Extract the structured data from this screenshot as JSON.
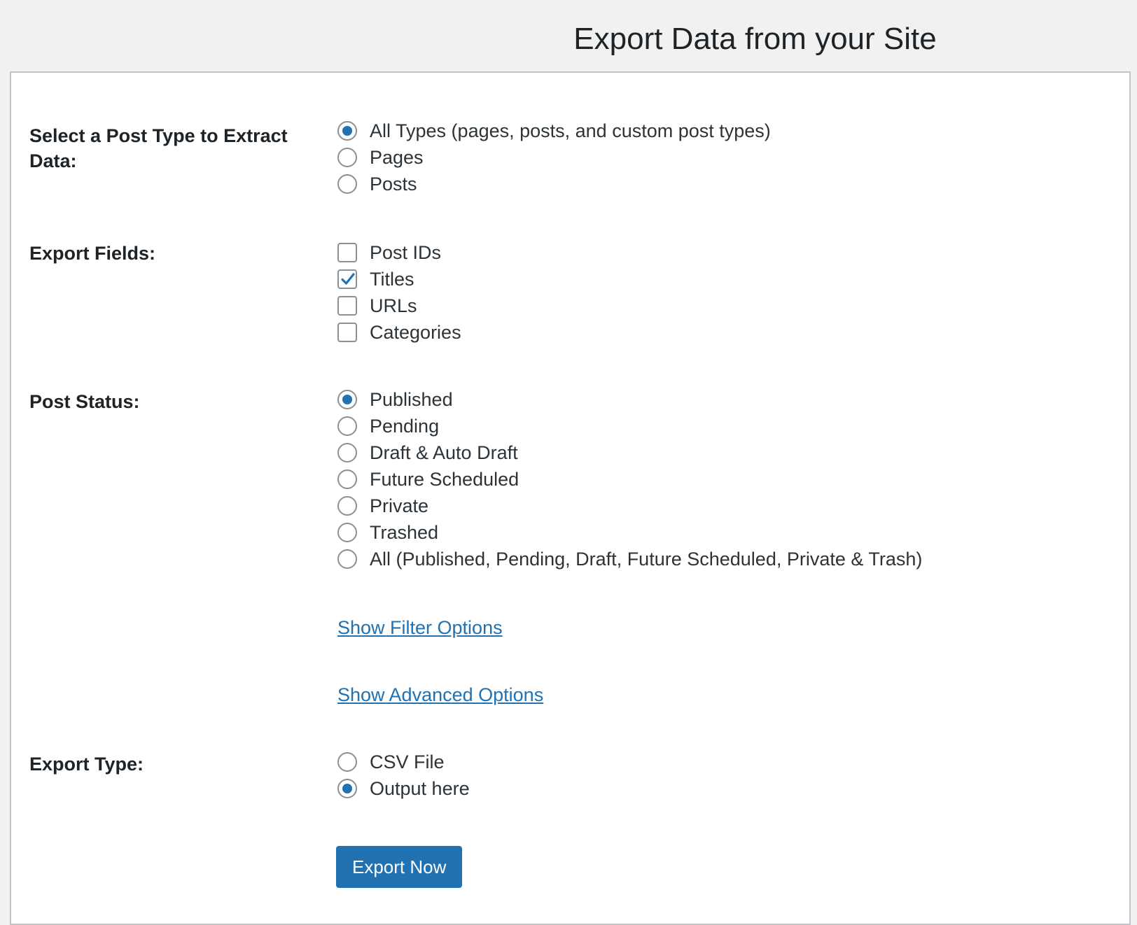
{
  "page": {
    "title": "Export Data from your Site"
  },
  "post_type": {
    "label": "Select a Post Type to Extract Data:",
    "options": [
      {
        "label": "All Types (pages, posts, and custom post types)",
        "checked": true
      },
      {
        "label": "Pages",
        "checked": false
      },
      {
        "label": "Posts",
        "checked": false
      }
    ]
  },
  "export_fields": {
    "label": "Export Fields:",
    "options": [
      {
        "label": "Post IDs",
        "checked": false
      },
      {
        "label": "Titles",
        "checked": true
      },
      {
        "label": "URLs",
        "checked": false
      },
      {
        "label": "Categories",
        "checked": false
      }
    ]
  },
  "post_status": {
    "label": "Post Status:",
    "options": [
      {
        "label": "Published",
        "checked": true
      },
      {
        "label": "Pending",
        "checked": false
      },
      {
        "label": "Draft & Auto Draft",
        "checked": false
      },
      {
        "label": "Future Scheduled",
        "checked": false
      },
      {
        "label": "Private",
        "checked": false
      },
      {
        "label": "Trashed",
        "checked": false
      },
      {
        "label": "All (Published, Pending, Draft, Future Scheduled, Private & Trash)",
        "checked": false
      }
    ]
  },
  "links": {
    "filter_options": "Show Filter Options",
    "advanced_options": "Show Advanced Options"
  },
  "export_type": {
    "label": "Export Type:",
    "options": [
      {
        "label": "CSV File",
        "checked": false
      },
      {
        "label": "Output here",
        "checked": true
      }
    ]
  },
  "actions": {
    "export_label": "Export Now"
  },
  "colors": {
    "accent": "#2271b1",
    "background": "#f1f1f1",
    "panel": "#ffffff",
    "control_border": "#8c8f94"
  }
}
